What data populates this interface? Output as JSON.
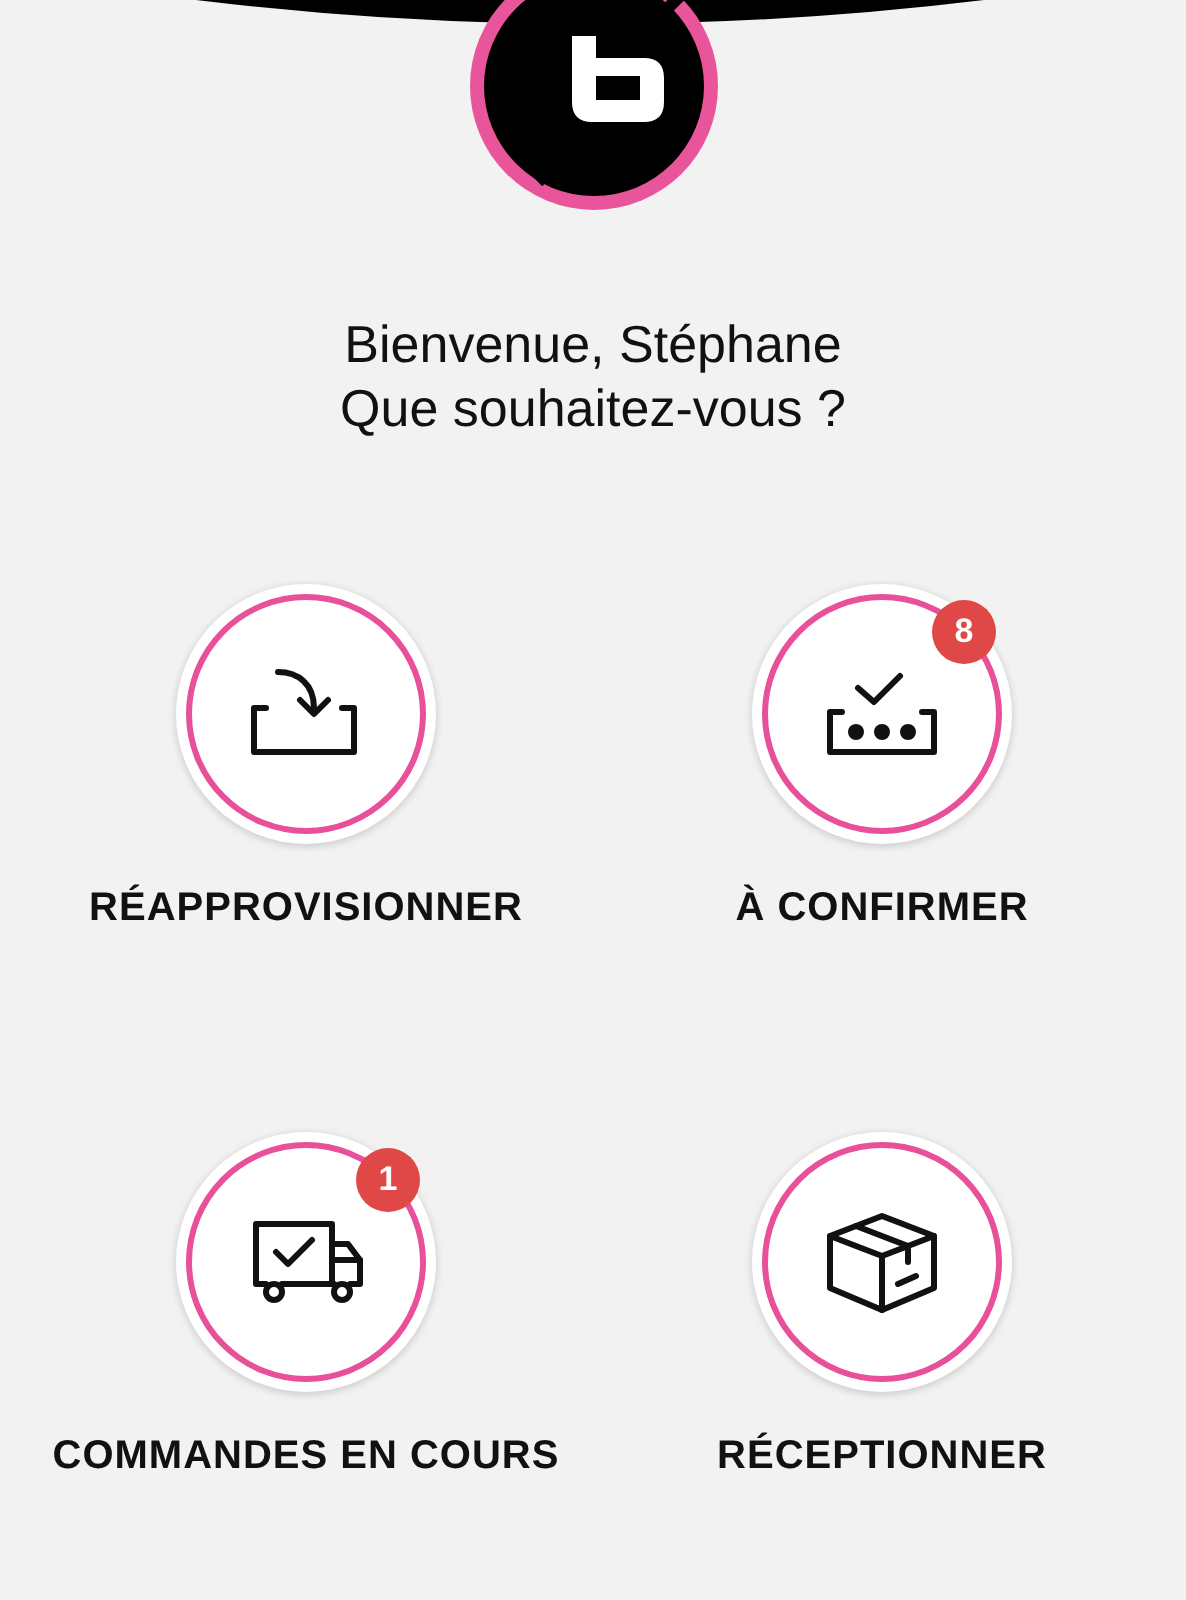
{
  "greeting": [
    "Bienvenue, Stéphane",
    "Que souhaitez-vous ?"
  ],
  "actions": [
    {
      "kind": "restock",
      "label": "RÉAPPROVISIONNER"
    },
    {
      "kind": "confirm",
      "label": "À CONFIRMER",
      "badge": "8"
    },
    {
      "kind": "orders",
      "label": "COMMANDES EN COURS",
      "badge": "1"
    },
    {
      "kind": "receive",
      "label": "RÉCEPTIONNER"
    }
  ]
}
